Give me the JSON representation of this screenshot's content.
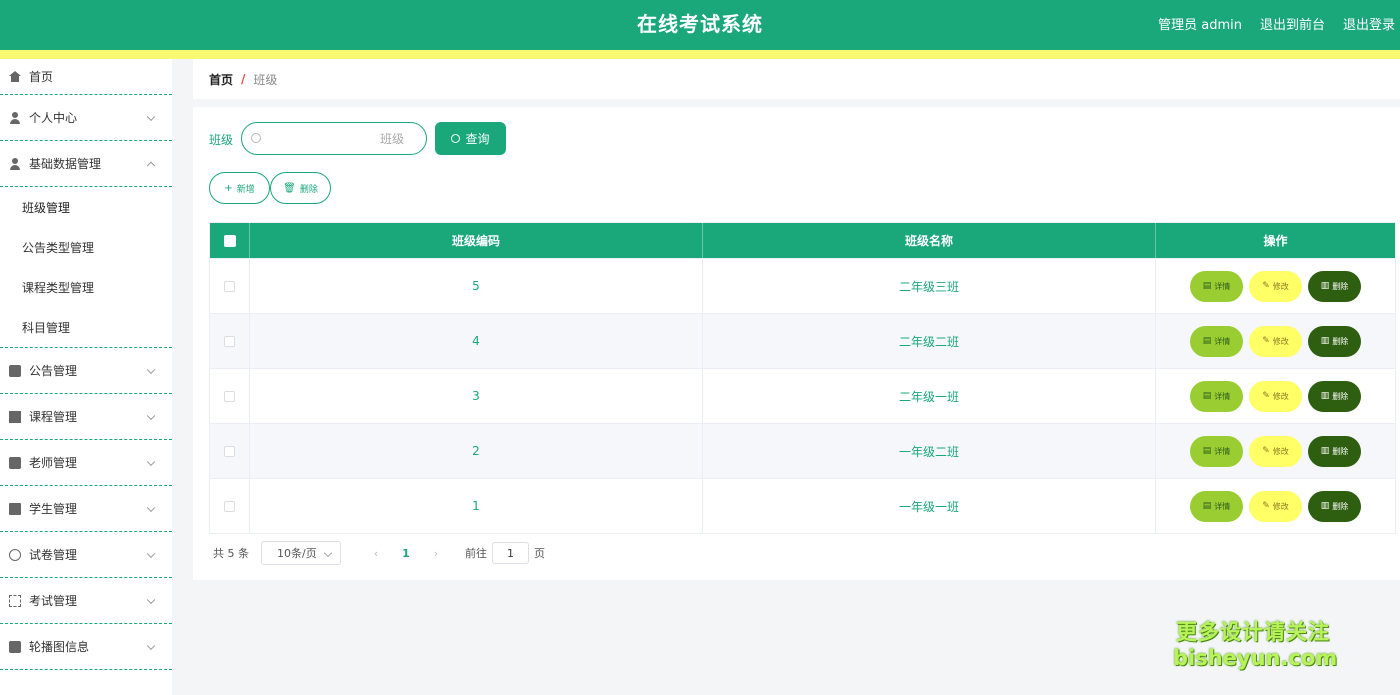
{
  "header": {
    "title": "在线考试系统",
    "user": "管理员 admin",
    "to_front": "退出到前台",
    "logout": "退出登录"
  },
  "sidebar": {
    "items": [
      {
        "label": "首页",
        "icon": "home-icon"
      },
      {
        "label": "个人中心",
        "icon": "user-icon"
      },
      {
        "label": "基础数据管理",
        "icon": "user-icon",
        "children": [
          "班级管理",
          "公告类型管理",
          "课程类型管理",
          "科目管理"
        ]
      },
      {
        "label": "公告管理",
        "icon": "notice-icon"
      },
      {
        "label": "课程管理",
        "icon": "book-icon"
      },
      {
        "label": "老师管理",
        "icon": "chat-icon"
      },
      {
        "label": "学生管理",
        "icon": "clipboard-icon"
      },
      {
        "label": "试卷管理",
        "icon": "compass-icon"
      },
      {
        "label": "考试管理",
        "icon": "frame-icon"
      },
      {
        "label": "轮播图信息",
        "icon": "briefcase-icon"
      }
    ]
  },
  "breadcrumb": {
    "home": "首页",
    "sep": "/",
    "current": "班级"
  },
  "search": {
    "label": "班级",
    "placeholder": "班级",
    "button": "查询"
  },
  "toolbar": {
    "add": "新增",
    "delete": "删除"
  },
  "table": {
    "headers": [
      "班级编码",
      "班级名称",
      "操作"
    ],
    "rows": [
      {
        "code": "5",
        "name": "二年级三班"
      },
      {
        "code": "4",
        "name": "二年级二班"
      },
      {
        "code": "3",
        "name": "二年级一班"
      },
      {
        "code": "2",
        "name": "一年级二班"
      },
      {
        "code": "1",
        "name": "一年级一班"
      }
    ],
    "actions": {
      "detail": "详情",
      "edit": "修改",
      "delete": "删除"
    }
  },
  "pagination": {
    "total": "共 5 条",
    "page_size": "10条/页",
    "current": "1",
    "goto": "前往",
    "goto_value": "1",
    "page_unit": "页"
  },
  "watermark": {
    "line1": "更多设计请关注",
    "line2": "bisheyun.com"
  },
  "colors": {
    "primary": "#1aa87a",
    "stripe": "#f8f871",
    "detail": "#9acd32",
    "edit": "#ffff66",
    "delete": "#2e5e0f"
  }
}
